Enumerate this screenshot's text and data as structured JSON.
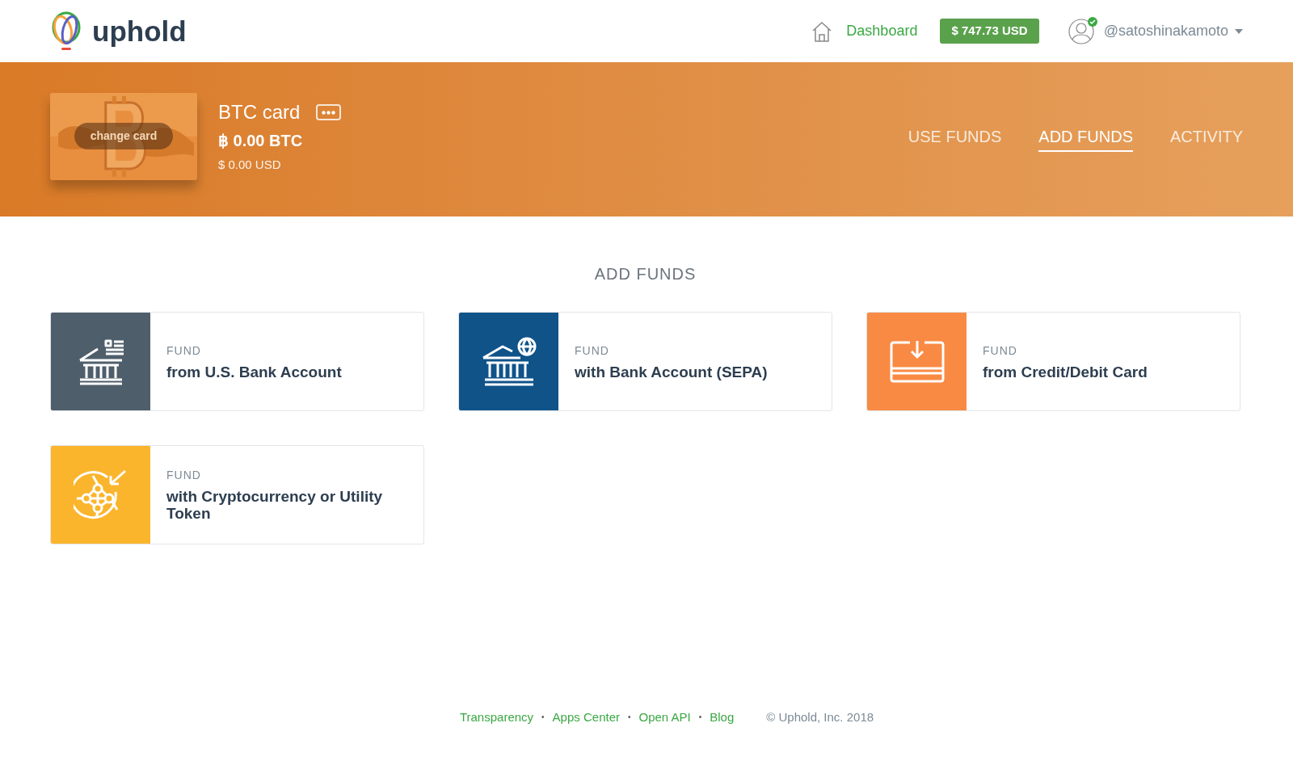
{
  "header": {
    "logo_text": "uphold",
    "nav_link": "Dashboard",
    "balance": "$ 747.73 USD",
    "username": "@satoshinakamoto",
    "verified": true
  },
  "card": {
    "action": "change card",
    "name": "BTC card",
    "balance": "฿ 0.00 BTC",
    "balance_usd": "$ 0.00 USD"
  },
  "tabs": [
    {
      "label": "USE FUNDS",
      "selected": false
    },
    {
      "label": "ADD FUNDS",
      "selected": true
    },
    {
      "label": "ACTIVITY",
      "selected": false
    }
  ],
  "section_title": "ADD FUNDS",
  "options": [
    {
      "kind": "us_bank",
      "color": "#4f5e6b",
      "label": "FUND",
      "title": "from U.S. Bank Account"
    },
    {
      "kind": "sepa",
      "color": "#0f5389",
      "label": "FUND",
      "title": "with Bank Account (SEPA)"
    },
    {
      "kind": "card",
      "color": "#f98a43",
      "label": "FUND",
      "title": "from Credit/Debit Card"
    },
    {
      "kind": "crypto",
      "color": "#fbb52d",
      "label": "FUND",
      "title": "with Cryptocurrency or Utility Token"
    }
  ],
  "footer": [
    {
      "kind": "link",
      "text": "Transparency"
    },
    {
      "kind": "dot",
      "text": "•"
    },
    {
      "kind": "link",
      "text": "Apps Center"
    },
    {
      "kind": "dot",
      "text": "•"
    },
    {
      "kind": "link",
      "text": "Open API"
    },
    {
      "kind": "dot",
      "text": "•"
    },
    {
      "kind": "link",
      "text": "Blog"
    },
    {
      "kind": "copyright",
      "text": "© Uphold, Inc. 2018"
    }
  ]
}
